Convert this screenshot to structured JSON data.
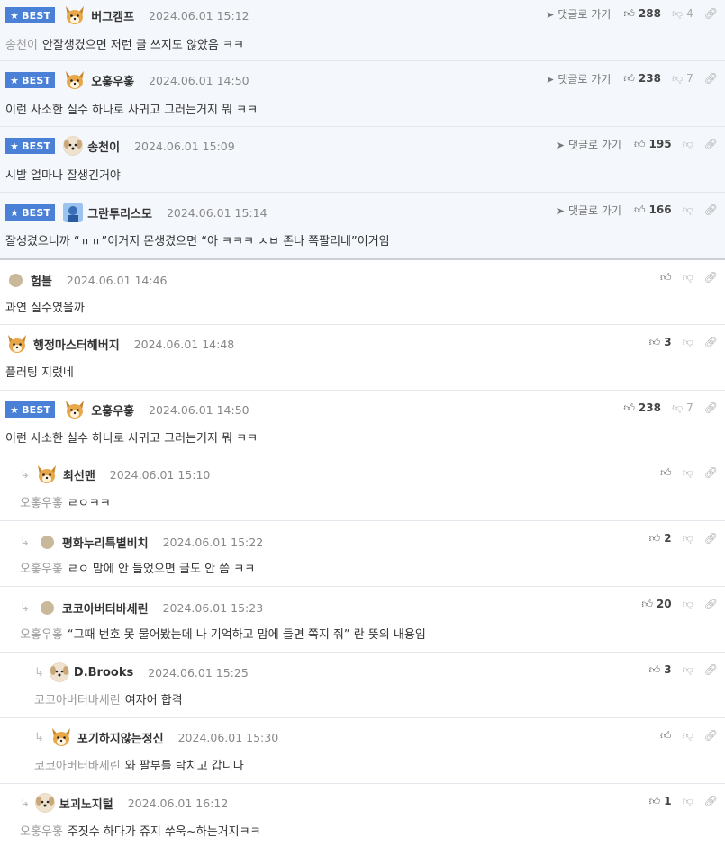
{
  "best_comments": [
    {
      "badge": "BEST",
      "nick": "버그캠프",
      "date": "2024.06.01 15:12",
      "goto": "댓글로 가기",
      "likes": "288",
      "dislikes": "4",
      "mention": "송천이",
      "text": "안잘생겼으면 저런 글 쓰지도 않았음 ㅋㅋ",
      "avatar": "fox"
    },
    {
      "badge": "BEST",
      "nick": "오홓우홓",
      "date": "2024.06.01 14:50",
      "goto": "댓글로 가기",
      "likes": "238",
      "dislikes": "7",
      "mention": "",
      "text": "이런 사소한 실수 하나로 사귀고 그러는거지 뭐 ㅋㅋ",
      "avatar": "fox"
    },
    {
      "badge": "BEST",
      "nick": "송천이",
      "date": "2024.06.01 15:09",
      "goto": "댓글로 가기",
      "likes": "195",
      "dislikes": "",
      "mention": "",
      "text": "시발 얼마나 잘생긴거야",
      "avatar": "dog"
    },
    {
      "badge": "BEST",
      "nick": "그란투리스모",
      "date": "2024.06.01 15:14",
      "goto": "댓글로 가기",
      "likes": "166",
      "dislikes": "",
      "mention": "",
      "text": "잘생겼으니까 “ㅠㅠ”이거지 몬생겼으면 “아 ㅋㅋㅋ ㅅㅂ 존나 쪽팔리네”이거임",
      "avatar": "photo"
    }
  ],
  "comments": [
    {
      "nick": "험블",
      "date": "2024.06.01 14:46",
      "likes": "",
      "dislikes": "",
      "text": "과연 실수였을까",
      "avatar": "dot",
      "depth": 0,
      "best": false,
      "mention": ""
    },
    {
      "nick": "행정마스터해버지",
      "date": "2024.06.01 14:48",
      "likes": "3",
      "dislikes": "",
      "text": "플러팅 지렸네",
      "avatar": "fox",
      "depth": 0,
      "best": false,
      "mention": ""
    },
    {
      "nick": "오홓우홓",
      "date": "2024.06.01 14:50",
      "likes": "238",
      "dislikes": "7",
      "text": "이런 사소한 실수 하나로 사귀고 그러는거지 뭐 ㅋㅋ",
      "avatar": "fox",
      "depth": 0,
      "best": true,
      "badge": "BEST",
      "mention": ""
    },
    {
      "nick": "최선맨",
      "date": "2024.06.01 15:10",
      "likes": "",
      "dislikes": "",
      "text": "ㄹㅇㅋㅋ",
      "avatar": "fox",
      "depth": 1,
      "best": false,
      "mention": "오홓우홓"
    },
    {
      "nick": "평화누리특별비치",
      "date": "2024.06.01 15:22",
      "likes": "2",
      "dislikes": "",
      "text": "ㄹㅇ 맘에 안 들었으면 글도 안 씀 ㅋㅋ",
      "avatar": "dot",
      "depth": 1,
      "best": false,
      "mention": "오홓우홓"
    },
    {
      "nick": "코코아버터바세린",
      "date": "2024.06.01 15:23",
      "likes": "20",
      "dislikes": "",
      "text": "“그때 번호 못 물어봤는데 나 기억하고 맘에 들면 쪽지 줘” 란 뜻의 내용임",
      "avatar": "dot",
      "depth": 1,
      "best": false,
      "mention": "오홓우홓"
    },
    {
      "nick": "D.Brooks",
      "date": "2024.06.01 15:25",
      "likes": "3",
      "dislikes": "",
      "text": "여자어 합격",
      "avatar": "dog",
      "depth": 2,
      "best": false,
      "mention": "코코아버터바세린"
    },
    {
      "nick": "포기하지않는정신",
      "date": "2024.06.01 15:30",
      "likes": "",
      "dislikes": "",
      "text": "와 팔부를 탁치고 갑니다",
      "avatar": "fox",
      "depth": 2,
      "best": false,
      "mention": "코코아버터바세린"
    },
    {
      "nick": "보괴노지털",
      "date": "2024.06.01 16:12",
      "likes": "1",
      "dislikes": "",
      "text": "주짓수 하다가 쥬지 쑤욱~하는거지ㅋㅋ",
      "avatar": "dog",
      "depth": 1,
      "best": false,
      "mention": "오홓우홓"
    }
  ],
  "icons": {
    "like": "thumbs-up-icon",
    "dislike": "thumbs-down-icon",
    "link": "link-icon",
    "goto": "location-arrow-icon",
    "reply": "reply-arrow-icon",
    "star": "star-icon"
  },
  "colors": {
    "best_badge": "#4a80d6",
    "best_row_bg": "#f4f7fb",
    "mention": "#999999"
  }
}
